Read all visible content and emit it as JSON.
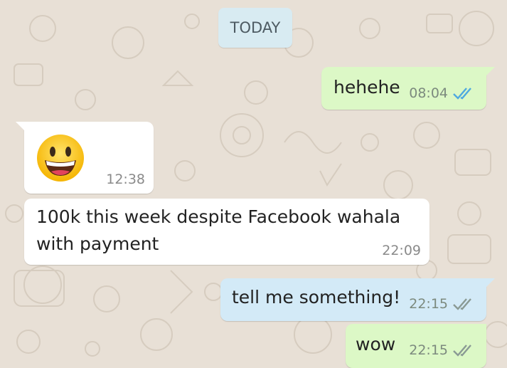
{
  "chat": {
    "date_label": "TODAY",
    "messages": [
      {
        "direction": "outgoing",
        "text": "hehehe",
        "time": "08:04",
        "status": "read",
        "tick_color": "#4fa9e0"
      },
      {
        "direction": "incoming",
        "emoji": "grinning-face",
        "time": "12:38"
      },
      {
        "direction": "incoming",
        "text_line1": "100k this week despite Facebook wahala",
        "text_line2": "with payment",
        "time": "22:09"
      },
      {
        "direction": "outgoing",
        "text": "tell me something!",
        "time": "22:15",
        "status": "delivered",
        "tick_color": "#8a9a94",
        "selected": true
      },
      {
        "direction": "outgoing",
        "text": "wow",
        "time": "22:15",
        "status": "delivered",
        "tick_color": "#8a9a94"
      }
    ]
  },
  "colors": {
    "wallpaper": "#e8e0d6",
    "outgoing_bubble": "#dcf8c6",
    "incoming_bubble": "#ffffff",
    "selected_bubble": "#d3eaf7",
    "date_pill": "#d8ebf2"
  }
}
